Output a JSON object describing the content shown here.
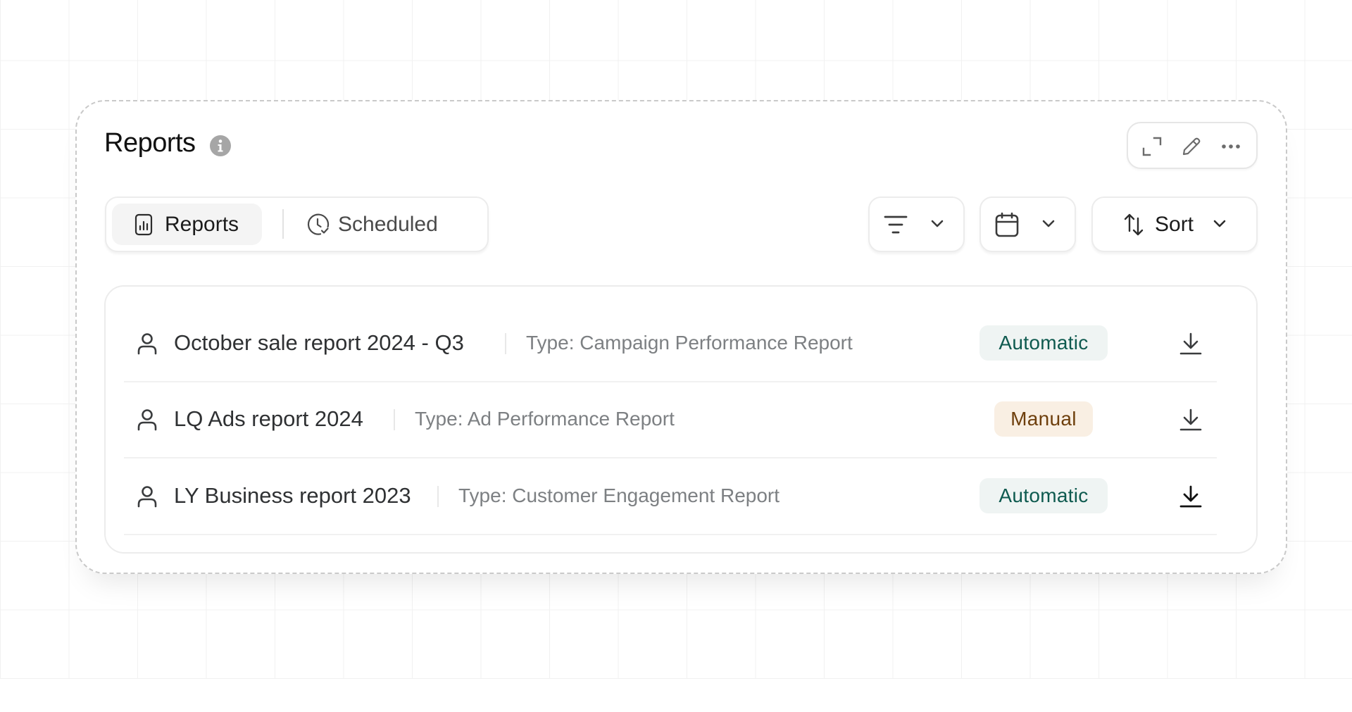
{
  "widget": {
    "title": "Reports",
    "info_icon": "info-icon",
    "actions": [
      {
        "name": "expand",
        "icon": "expand-icon"
      },
      {
        "name": "edit",
        "icon": "pencil-icon"
      },
      {
        "name": "more",
        "icon": "more-horizontal-icon"
      }
    ]
  },
  "tabs": [
    {
      "label": "Reports",
      "icon": "bar-chart-report-icon",
      "active": true
    },
    {
      "label": "Scheduled",
      "icon": "clock-check-icon",
      "active": false
    }
  ],
  "controls": {
    "filter": {
      "icon": "filter-lines-icon",
      "dropdown": "chevron-down-icon"
    },
    "date": {
      "icon": "calendar-icon",
      "dropdown": "chevron-down-icon"
    },
    "sort": {
      "label": "Sort",
      "icon": "sort-arrows-icon",
      "dropdown": "chevron-down-icon"
    }
  },
  "reports": [
    {
      "name": "October sale report 2024 - Q3",
      "type": "Type: Campaign Performance Report",
      "mode": "Automatic",
      "owner_icon": "user-icon",
      "action_icon": "download-icon"
    },
    {
      "name": "LQ Ads report 2024",
      "type": "Type: Ad Performance Report",
      "mode": "Manual",
      "owner_icon": "user-icon",
      "action_icon": "download-icon"
    },
    {
      "name": "LY Business report 2023",
      "type": "Type: Customer Engagement Report",
      "mode": "Automatic",
      "owner_icon": "user-icon",
      "action_icon": "download-icon"
    }
  ],
  "colors": {
    "automatic_badge_bg": "#eff4f3",
    "automatic_badge_text": "#0e5a4f",
    "manual_badge_bg": "#f9efe3",
    "manual_badge_text": "#6e3f0c",
    "active_tab_bg": "#f4f4f4",
    "info_icon": "#a6a6a6"
  }
}
